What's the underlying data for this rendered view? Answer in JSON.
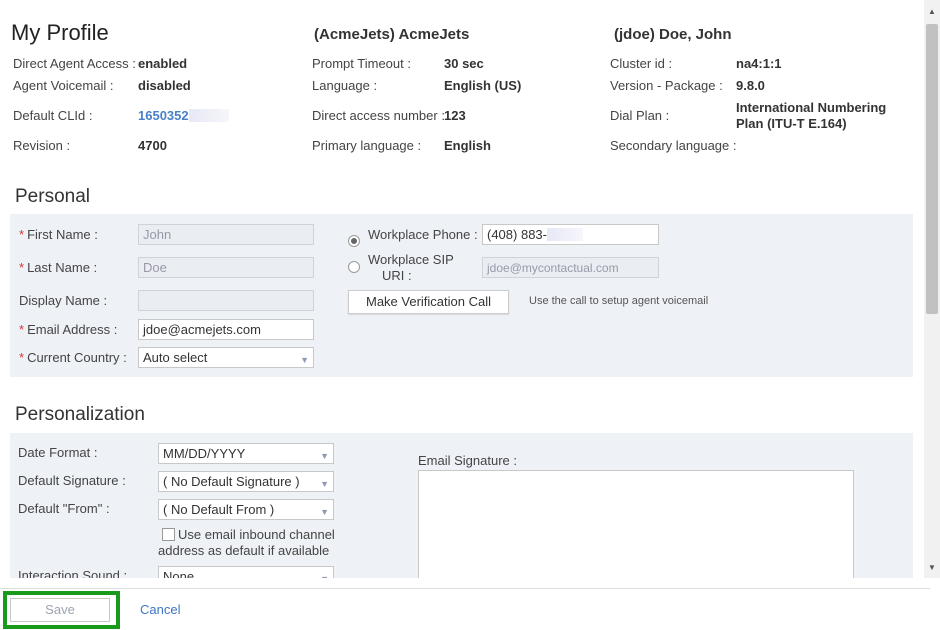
{
  "header": {
    "title": "My Profile",
    "tenant": "(AcmeJets) AcmeJets",
    "user": "(jdoe) Doe, John"
  },
  "info": {
    "direct_agent_access_label": "Direct Agent Access :",
    "direct_agent_access_value": "enabled",
    "agent_voicemail_label": "Agent Voicemail :",
    "agent_voicemail_value": "disabled",
    "default_clid_label": "Default CLId :",
    "default_clid_value": "1650352",
    "revision_label": "Revision :",
    "revision_value": "4700",
    "prompt_timeout_label": "Prompt Timeout :",
    "prompt_timeout_value": "30 sec",
    "language_label": "Language :",
    "language_value": "English (US)",
    "direct_access_number_label": "Direct access number :",
    "direct_access_number_value": "123",
    "primary_language_label": "Primary language :",
    "primary_language_value": "English",
    "cluster_id_label": "Cluster id :",
    "cluster_id_value": "na4:1:1",
    "version_package_label": "Version - Package :",
    "version_package_value": "9.8.0",
    "dial_plan_label": "Dial Plan :",
    "dial_plan_value_line1": "International Numbering",
    "dial_plan_value_line2": "Plan (ITU-T E.164)",
    "secondary_language_label": "Secondary language :"
  },
  "personal": {
    "section_title": "Personal",
    "required_marker": "*",
    "first_name_label": "First Name :",
    "first_name_value": "John",
    "last_name_label": "Last Name :",
    "last_name_value": "Doe",
    "display_name_label": "Display Name :",
    "display_name_value": "",
    "email_label": "Email Address :",
    "email_value": "jdoe@acmejets.com",
    "country_label": "Current Country :",
    "country_value": "Auto select",
    "workplace_phone_label": "Workplace Phone :",
    "workplace_phone_value": "(408) 883-",
    "workplace_sip_label_line1": "Workplace SIP",
    "workplace_sip_label_line2": "URI :",
    "workplace_sip_value": "jdoe@mycontactual.com",
    "verification_button": "Make Verification Call",
    "verification_hint": "Use the call to setup agent voicemail"
  },
  "personalization": {
    "section_title": "Personalization",
    "date_format_label": "Date Format :",
    "date_format_value": "MM/DD/YYYY",
    "default_signature_label": "Default Signature :",
    "default_signature_value": "( No Default Signature )",
    "default_from_label": "Default \"From\" :",
    "default_from_value": "( No Default From )",
    "use_inbound_line1": "Use email inbound channel",
    "use_inbound_line2": "address as default if available",
    "interaction_sound_label": "Interaction Sound :",
    "interaction_sound_value": "None",
    "email_signature_label": "Email Signature :"
  },
  "footer": {
    "save_label": "Save",
    "cancel_label": "Cancel"
  },
  "colors": {
    "highlight": "#1a9a1a",
    "link": "#3f74c4",
    "required": "#dd3333",
    "panel": "#eef1f6"
  }
}
